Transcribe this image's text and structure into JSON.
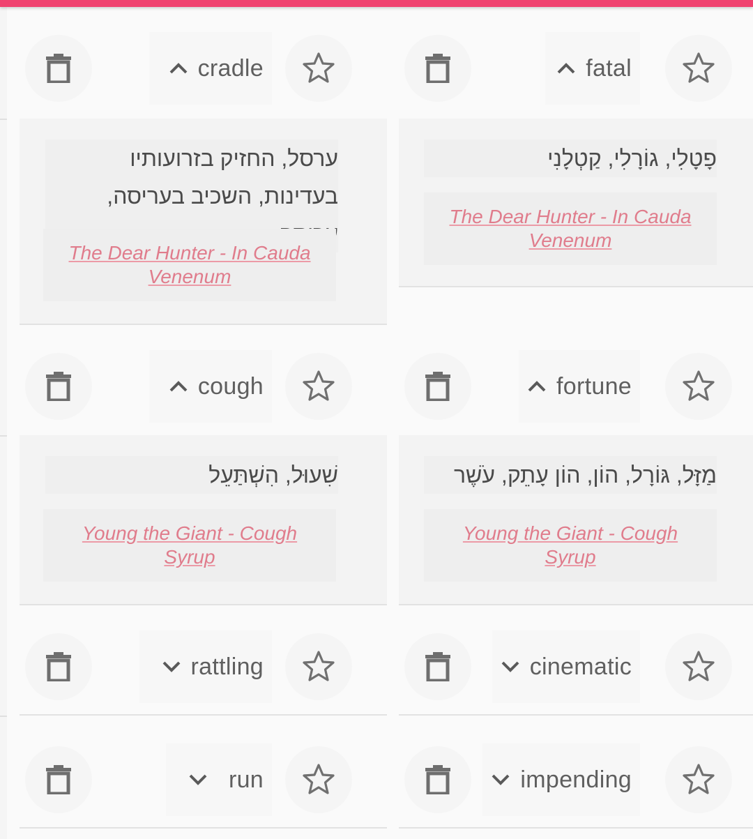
{
  "theme": {
    "accent": "#f0426f",
    "link_color": "#e07c8c"
  },
  "cards": [
    {
      "word": "cradle",
      "expanded": true,
      "translation": "ערסל, החזיק בזרועותיו בעדינות, השכיב בעריסה, עֲרִיסָה",
      "song_line1": "The Dear Hunter - In Cauda",
      "song_line2": "Venenum"
    },
    {
      "word": "fatal",
      "expanded": true,
      "translation": "פָטָלִי, גוֹרָלִי, קַטְלָנִי",
      "song_line1": "The Dear Hunter - In Cauda",
      "song_line2": "Venenum"
    },
    {
      "word": "cough",
      "expanded": true,
      "translation": "שִׁעוּל, הִשְׁתַּעֵל",
      "song_line1": "Young the Giant - Cough",
      "song_line2": "Syrup"
    },
    {
      "word": "fortune",
      "expanded": true,
      "translation": "מַזָּל, גּוֹרָל, הוֹן, הוֹן עָתֵק, עֹשֶׁר",
      "song_line1": "Young the Giant - Cough",
      "song_line2": "Syrup"
    },
    {
      "word": "rattling",
      "expanded": false
    },
    {
      "word": "cinematic",
      "expanded": false
    },
    {
      "word": "run",
      "expanded": false
    },
    {
      "word": "impending",
      "expanded": false
    }
  ],
  "icons": {
    "delete": "trash-icon",
    "favorite": "star-outline-icon",
    "collapse": "chevron-up-icon",
    "expand": "chevron-down-icon"
  }
}
